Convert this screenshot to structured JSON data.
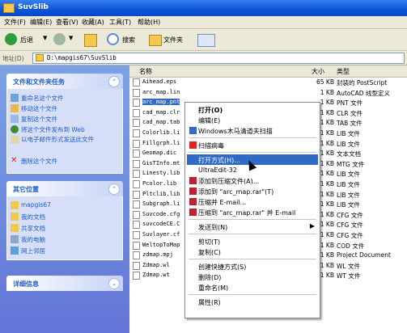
{
  "window": {
    "title": "SuvSlib"
  },
  "menu": [
    "文件(F)",
    "编辑(E)",
    "查看(V)",
    "收藏(A)",
    "工具(T)",
    "帮助(H)"
  ],
  "toolbar": {
    "back": "后退",
    "search": "搜索",
    "folders": "文件夹"
  },
  "address": {
    "label": "地址(D)",
    "path": "D:\\mapgis67\\SuvSlib"
  },
  "tasks_panel": {
    "title": "文件和文件夹任务",
    "items": [
      "重命名这个文件",
      "移动这个文件",
      "复制这个文件",
      "将这个文件发布到 Web",
      "以电子邮件形式发送此文件",
      "删除这个文件"
    ]
  },
  "places_panel": {
    "title": "其它位置",
    "items": [
      "mapgis67",
      "我的文档",
      "共享文档",
      "我的电脑",
      "网上邻居"
    ]
  },
  "details_panel": {
    "title": "详细信息"
  },
  "columns": {
    "name": "名称",
    "size": "大小",
    "type": "类型"
  },
  "files": [
    {
      "name": "Aihead.eps",
      "size": "65 KB",
      "type": "封装的 PostScript"
    },
    {
      "name": "arc_map.lin",
      "size": "1 KB",
      "type": "AutoCAD 线型定义"
    },
    {
      "name": "arc_map.pnt",
      "size": "1 KB",
      "type": "PNT 文件"
    },
    {
      "name": "cad_map.clr",
      "size": "1 KB",
      "type": "CLR 文件"
    },
    {
      "name": "cad_map.tab",
      "size": "1 KB",
      "type": "TAB 文件"
    },
    {
      "name": "Colorlib.li",
      "size": "1 KB",
      "type": "LIB 文件"
    },
    {
      "name": "Fillgrph.li",
      "size": "1 KB",
      "type": "LIB 文件"
    },
    {
      "name": "Geomap.dic",
      "size": "1 KB",
      "type": "文本文档"
    },
    {
      "name": "GisTInfo.mt",
      "size": "1 KB",
      "type": "MTG 文件"
    },
    {
      "name": "Linesty.lib",
      "size": "1 KB",
      "type": "LIB 文件"
    },
    {
      "name": "Pcolor.lib",
      "size": "1 KB",
      "type": "LIB 文件"
    },
    {
      "name": "Pltclib.lib",
      "size": "1 KB",
      "type": "LIB 文件"
    },
    {
      "name": "Subgraph.li",
      "size": "1 KB",
      "type": "LIB 文件"
    },
    {
      "name": "Suvcode.cfg",
      "size": "1 KB",
      "type": "CFG 文件"
    },
    {
      "name": "suvcodeCE.C",
      "size": "1 KB",
      "type": "CFG 文件"
    },
    {
      "name": "Suvlayer.cf",
      "size": "1 KB",
      "type": "CFG 文件"
    },
    {
      "name": "WeltopToMap",
      "size": "1 KB",
      "type": "COD 文件"
    },
    {
      "name": "zdmap.mpj",
      "size": "1 KB",
      "type": "Project Document"
    },
    {
      "name": "Zdmap.wl",
      "size": "1 KB",
      "type": "WL 文件"
    },
    {
      "name": "Zdmap.wt",
      "size": "1 KB",
      "type": "WT 文件"
    }
  ],
  "context_menu": [
    {
      "label": "打开(O)",
      "bold": true
    },
    {
      "label": "编辑(E)"
    },
    {
      "label": "Windows木马清道夫扫描"
    },
    {
      "sep": true
    },
    {
      "label": "扫描病毒"
    },
    {
      "sep": true
    },
    {
      "label": "打开方式(H)...",
      "highlight": true
    },
    {
      "label": "UltraEdit-32"
    },
    {
      "label": "添加到压缩文件(A)..."
    },
    {
      "label": "添加到 \"arc_map.rar\"(T)"
    },
    {
      "label": "压缩并 E-mail..."
    },
    {
      "label": "压缩到 \"arc_map.rar\" 并 E-mail"
    },
    {
      "sep": true
    },
    {
      "label": "发送到(N)",
      "submenu": true
    },
    {
      "sep": true
    },
    {
      "label": "剪切(T)"
    },
    {
      "label": "复制(C)"
    },
    {
      "sep": true
    },
    {
      "label": "创建快捷方式(S)"
    },
    {
      "label": "删除(D)"
    },
    {
      "label": "重命名(M)"
    },
    {
      "sep": true
    },
    {
      "label": "属性(R)"
    }
  ],
  "colors": {
    "title_blue": "#0b55d8",
    "link_blue": "#215dc6",
    "highlight": "#316ac5"
  }
}
